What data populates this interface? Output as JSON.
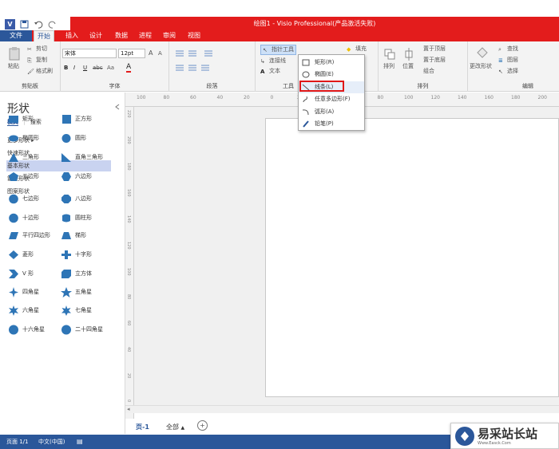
{
  "window": {
    "title": "绘图1 - Visio Professional(产品激活失败)",
    "app_icon": "V"
  },
  "tabs": [
    "文件",
    "开始",
    "插入",
    "设计",
    "数据",
    "进程",
    "审阅",
    "视图"
  ],
  "ribbon": {
    "clipboard": {
      "label": "剪贴板",
      "paste": "粘贴",
      "cut": "剪切",
      "copy": "复制",
      "format_painter": "格式刷"
    },
    "font": {
      "label": "字体",
      "font_name": "宋体",
      "font_size": "12pt",
      "grow": "A",
      "shrink": "A",
      "bold": "B",
      "italic": "I",
      "underline": "U",
      "strike": "abc",
      "case": "Aa",
      "color": "A"
    },
    "paragraph": {
      "label": "段落"
    },
    "tools": {
      "label": "工具",
      "pointer": "指针工具",
      "connector": "连接线",
      "text": "文本"
    },
    "shape_styles": {
      "fill": "填充"
    },
    "arrange": {
      "label": "排列",
      "arrange_btn": "排列",
      "position": "位置",
      "bring_front": "置于顶层",
      "send_back": "置于底层",
      "group": "组合"
    },
    "change_shape": {
      "label": "更改形状"
    },
    "editing": {
      "label": "编辑",
      "find": "查找",
      "layers": "图层",
      "select": "选择"
    }
  },
  "dropdown": {
    "items": [
      "矩形(R)",
      "椭圆(E)",
      "线条(L)",
      "任意多边形(F)",
      "弧形(A)",
      "铅笔(P)"
    ],
    "highlighted": "线条(L)"
  },
  "panel": {
    "title": "形状",
    "tab_stencils": "模具",
    "tab_search": "搜索",
    "stencils": [
      "更多形状",
      "快速形状",
      "基本形状",
      "箭头形状",
      "图案形状"
    ],
    "selected_stencil": "基本形状",
    "shapes": [
      [
        "矩形",
        "正方形"
      ],
      [
        "椭圆形",
        "圆形"
      ],
      [
        "三角形",
        "直角三角形"
      ],
      [
        "五边形",
        "六边形"
      ],
      [
        "七边形",
        "八边形"
      ],
      [
        "十边形",
        "圆柱形"
      ],
      [
        "平行四边形",
        "梯形"
      ],
      [
        "菱形",
        "十字形"
      ],
      [
        "V 形",
        "立方体"
      ],
      [
        "四角星",
        "五角星"
      ],
      [
        "六角星",
        "七角星"
      ],
      [
        "十六角星",
        "二十四角星"
      ]
    ]
  },
  "ruler": {
    "h_ticks": [
      "100",
      "80",
      "60",
      "40",
      "20",
      "0",
      "20",
      "40",
      "60",
      "80",
      "100",
      "120",
      "140",
      "160",
      "180",
      "200"
    ],
    "v_ticks": [
      "220",
      "200",
      "180",
      "160",
      "140",
      "120",
      "100",
      "80",
      "60",
      "40",
      "20",
      "0"
    ]
  },
  "page_tabs": {
    "page": "页-1",
    "all": "全部",
    "add": "+"
  },
  "statusbar": {
    "page": "页面 1/1",
    "lang": "中文(中国)"
  },
  "watermark": {
    "text": "易采站长站",
    "sub": "Www.Easck.Com"
  },
  "colors": {
    "accent": "#2b579a",
    "title_red": "#e31c1c",
    "highlight": "#e01818",
    "shape_blue": "#2e75b6"
  }
}
